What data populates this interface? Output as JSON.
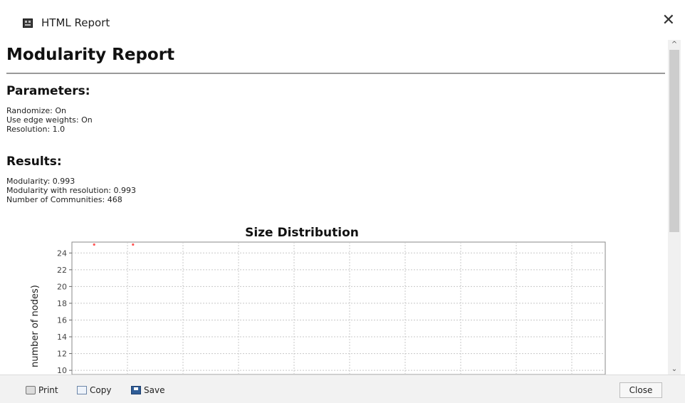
{
  "window": {
    "title": "HTML Report",
    "close_glyph": "✕"
  },
  "report": {
    "title": "Modularity Report",
    "parameters": {
      "heading": "Parameters:",
      "lines": [
        "Randomize: On",
        "Use edge weights: On",
        "Resolution: 1.0"
      ]
    },
    "results": {
      "heading": "Results:",
      "lines": [
        "Modularity: 0.993",
        "Modularity with resolution: 0.993",
        "Number of Communities: 468"
      ]
    }
  },
  "chart_data": {
    "type": "scatter",
    "title": "Size Distribution",
    "ylabel": "number of nodes)",
    "xlabel": "",
    "yticks": [
      10,
      12,
      14,
      16,
      18,
      20,
      22,
      24
    ],
    "ylim_visible": [
      9.5,
      25.3
    ],
    "grid": true,
    "point_color": "#ff5555",
    "points": [
      {
        "x_index": 0.4,
        "y": 25
      },
      {
        "x_index": 1.1,
        "y": 25
      }
    ]
  },
  "scrollbar": {
    "up_glyph": "^",
    "down_glyph": "⌄"
  },
  "toolbar": {
    "print_label": "Print",
    "copy_label": "Copy",
    "save_label": "Save",
    "close_label": "Close"
  },
  "icons": [
    "app-icon",
    "print-icon",
    "copy-icon",
    "save-icon",
    "close-icon"
  ]
}
